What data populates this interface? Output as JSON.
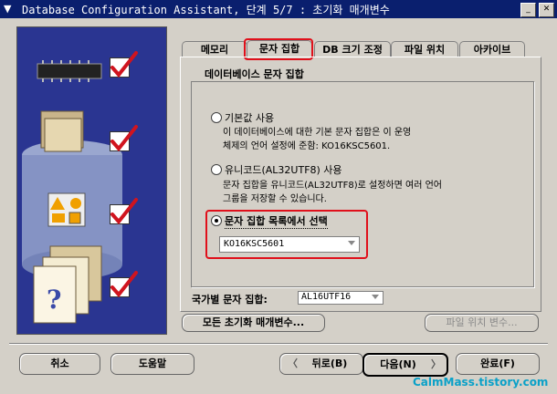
{
  "window": {
    "title": "Database Configuration Assistant, 단계 5/7 : 초기화 매개변수"
  },
  "tabs": [
    {
      "label": "메모리"
    },
    {
      "label": "문자 집합"
    },
    {
      "label": "DB 크기 조정"
    },
    {
      "label": "파일 위치"
    },
    {
      "label": "아카이브"
    }
  ],
  "charset": {
    "group_label": "데이터베이스 문자 집합",
    "option_default": {
      "label": "기본값 사용",
      "desc1": "이 데이터베이스에 대한 기본 문자 집합은 이 운영",
      "desc2": "체제의 언어 설정에 준함: KO16KSC5601."
    },
    "option_unicode": {
      "label": "유니코드(AL32UTF8) 사용",
      "desc1": "문자 집합을 유니코드(AL32UTF8)로 설정하면 여러 언어",
      "desc2": "그룹을 저장할 수 있습니다."
    },
    "option_list": {
      "label": "문자 집합 목록에서 선택",
      "selected_value": "KO16KSC5601"
    },
    "national_label": "국가별 문자 집합:",
    "national_value": "AL16UTF16"
  },
  "buttons": {
    "all_params": "모든 초기화 매개변수...",
    "file_location_vars": "파일 위치 변수...",
    "cancel": "취소",
    "help": "도움말",
    "back": "뒤로(B)",
    "next": "다음(N)",
    "finish": "완료(F)"
  },
  "watermark": "CalmMass.tistory.com",
  "colors": {
    "title_bar": "#0a1f6e",
    "left_panel": "#2a3591",
    "highlight": "#e0101b",
    "checkmark": "#d0141e"
  }
}
